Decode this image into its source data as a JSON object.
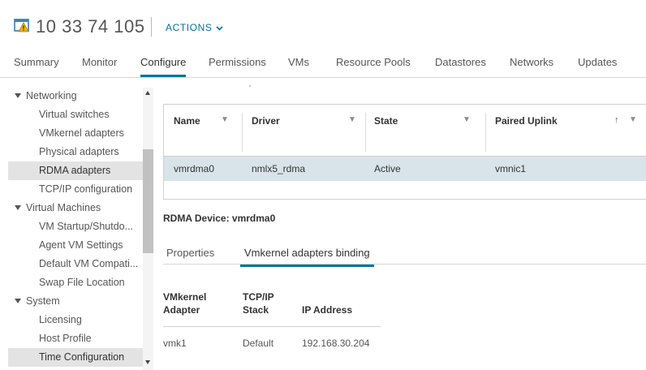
{
  "header": {
    "host_name": "10 33 74 105",
    "actions_label": "ACTIONS",
    "colors": {
      "accent": "#0072a3",
      "warning": "#f0b400"
    }
  },
  "tabs": [
    {
      "label": "Summary"
    },
    {
      "label": "Monitor"
    },
    {
      "label": "Configure",
      "active": true
    },
    {
      "label": "Permissions"
    },
    {
      "label": "VMs"
    },
    {
      "label": "Resource Pools"
    },
    {
      "label": "Datastores"
    },
    {
      "label": "Networks"
    },
    {
      "label": "Updates"
    }
  ],
  "sidebar": {
    "items": [
      {
        "label": "Networking",
        "kind": "group"
      },
      {
        "label": "Virtual switches",
        "kind": "sub"
      },
      {
        "label": "VMkernel adapters",
        "kind": "sub"
      },
      {
        "label": "Physical adapters",
        "kind": "sub"
      },
      {
        "label": "RDMA adapters",
        "kind": "sub",
        "selected": true
      },
      {
        "label": "TCP/IP configuration",
        "kind": "sub"
      },
      {
        "label": "Virtual Machines",
        "kind": "group"
      },
      {
        "label": "VM Startup/Shutdo...",
        "kind": "sub"
      },
      {
        "label": "Agent VM Settings",
        "kind": "sub"
      },
      {
        "label": "Default VM Compati...",
        "kind": "sub"
      },
      {
        "label": "Swap File Location",
        "kind": "sub"
      },
      {
        "label": "System",
        "kind": "group"
      },
      {
        "label": "Licensing",
        "kind": "sub"
      },
      {
        "label": "Host Profile",
        "kind": "sub"
      },
      {
        "label": "Time Configuration",
        "kind": "sub"
      }
    ]
  },
  "main": {
    "dot": "·",
    "grid": {
      "columns": [
        "Name",
        "Driver",
        "State",
        "Paired Uplink"
      ],
      "rows": [
        {
          "name": "vmrdma0",
          "driver": "nmlx5_rdma",
          "state": "Active",
          "uplink": "vmnic1"
        }
      ]
    },
    "detail_title": "RDMA Device: vmrdma0",
    "detail_tabs": [
      {
        "label": "Properties"
      },
      {
        "label": "Vmkernel adapters binding",
        "active": true
      }
    ],
    "binding_table": {
      "headers": {
        "adapter_line1": "VMkernel",
        "adapter_line2": "Adapter",
        "stack_line1": "TCP/IP",
        "stack_line2": "Stack",
        "ip": "IP Address"
      },
      "rows": [
        {
          "adapter": "vmk1",
          "stack": "Default",
          "ip": "192.168.30.204"
        }
      ]
    }
  }
}
